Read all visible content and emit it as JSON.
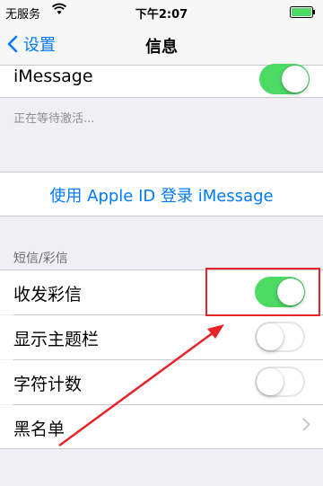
{
  "status_bar": {
    "carrier": "无服务",
    "time": "下午2:07",
    "wifi_icon": "wifi-icon",
    "battery_icon": "battery-icon"
  },
  "nav": {
    "back_label": "设置",
    "title": "信息"
  },
  "imessage": {
    "label": "iMessage",
    "toggle": "on"
  },
  "activation_note": "正在等待激活...",
  "apple_id_link": "使用 Apple ID 登录 iMessage",
  "sms_mms_section": {
    "header": "短信/彩信",
    "rows": [
      {
        "label": "收发彩信",
        "toggle": "on"
      },
      {
        "label": "显示主题栏",
        "toggle": "off"
      },
      {
        "label": "字符计数",
        "toggle": "off"
      },
      {
        "label": "黑名单",
        "accessory": "chevron-right-icon"
      }
    ]
  },
  "colors": {
    "accent": "#007aff",
    "toggle_on": "#4cd964",
    "annotation": "#e8242a",
    "background": "#efeff4"
  }
}
